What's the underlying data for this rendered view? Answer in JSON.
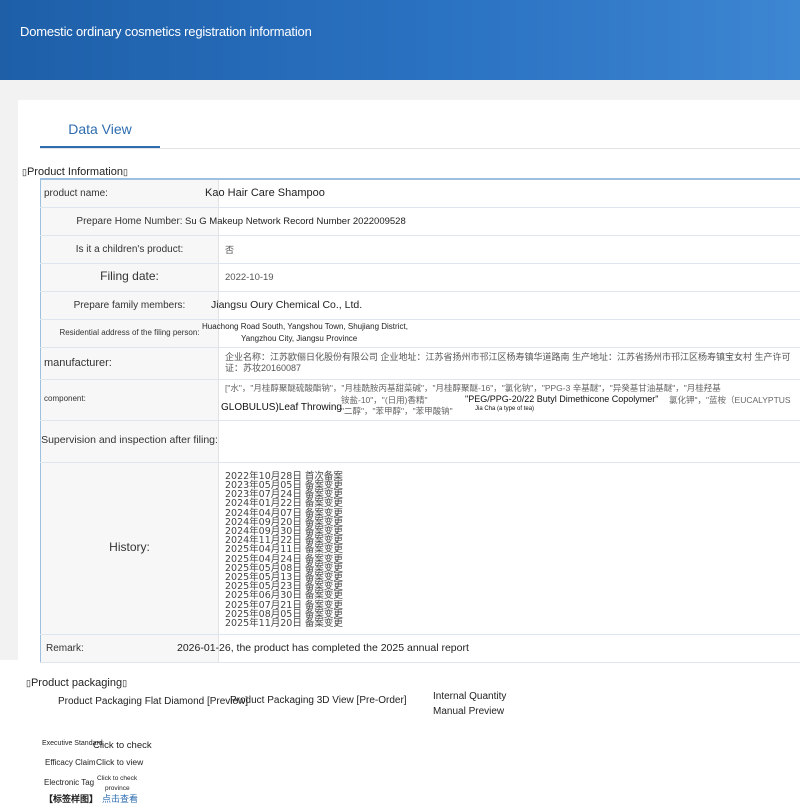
{
  "header": {
    "title": "Domestic ordinary cosmetics registration information"
  },
  "tabs": [
    {
      "label": "Data View"
    }
  ],
  "product_section": {
    "title": "Product Information"
  },
  "rows": {
    "product_name": {
      "label": "product name:",
      "value": "Kao Hair Care Shampoo"
    },
    "record_number": {
      "label": "Prepare Home Number:",
      "value": "Su G Makeup Network Record Number 2022009528"
    },
    "children": {
      "label": "Is it a children's product:",
      "value": "否"
    },
    "filing_date": {
      "label": "Filing date:",
      "value": "2022-10-19"
    },
    "family_members": {
      "label": "Prepare family members:",
      "value": "Jiangsu Oury Chemical Co., Ltd."
    },
    "residential": {
      "label": "Residential address of the filing person:",
      "value_line1": "Huachong Road South, Yangshou Town, Shujiang District,",
      "value_line2": "Yangzhou City, Jiangsu Province"
    },
    "manufacturer": {
      "label": "manufacturer:",
      "value": "企业名称：江苏欧俪日化股份有限公司 企业地址：江苏省扬州市邗江区杨寿镇华道路南 生产地址：江苏省扬州市邗江区杨寿镇宝女村 生产许可证：苏妆20160087"
    },
    "component": {
      "label": "component:",
      "value_cn1": "[\"水\"，\"月桂醇聚醚硫酸酯钠\"，\"月桂酰胺丙基甜菜碱\"，\"月桂醇聚醚-16\"，\"氯化钠\"，\"PPG-3 辛基醚\"，\"异癸基甘油基醚\"，\"月桂羟基",
      "value_cn2": "铵盐-10\"，\"(日用)香精\"",
      "value_en1": "\"PEG/PPG-20/22 Butyl Dimethicone Copolymer\"",
      "value_cn3": "氯化钾\"，\"蓝桉（EUCALYPTUS",
      "value_en2": "GLOBULUS)Leaf Throwing",
      "value_cn4": "\"二醇\"，\"苯甲醇\"，\"苯甲酸钠\"",
      "value_en3": "Jia Cha (a type of tea)"
    },
    "supervision": {
      "label": "Supervision and inspection after filing:",
      "value": ""
    },
    "history": {
      "label": "History:",
      "items": [
        "2022年10月28日 首次备案",
        "2023年05月05日 备案变更",
        "2023年07月24日 备案变更",
        "2024年01月22日 备案变更",
        "2024年04月07日 备案变更",
        "2024年09月20日 备案变更",
        "2024年09月30日 备案变更",
        "2024年11月22日 备案变更",
        "2025年04月11日 备案变更",
        "2025年04月24日 备案变更",
        "2025年05月08日 备案变更",
        "2025年05月13日 备案变更",
        "2025年05月23日 备案变更",
        "2025年06月30日 备案变更",
        "2025年07月21日 备案变更",
        "2025年08月05日 备案变更",
        "2025年11月20日 备案变更"
      ]
    },
    "remark": {
      "label": "Remark:",
      "value": "2026-01-26, the product has completed the 2025 annual report"
    }
  },
  "packaging": {
    "title": "Product packaging",
    "flat": "Product Packaging Flat Diamond [Preview]",
    "view3d": "Product Packaging 3D View [Pre-Order]",
    "internal_line1": "Internal Quantity",
    "internal_line2": "Manual Preview"
  },
  "extras": {
    "exec_label": "Executive Standard",
    "exec_link": "Click to check",
    "efficacy_label": "Efficacy Claim",
    "efficacy_link": "Click to view",
    "etag_label": "Electronic Tag",
    "etag_link_line1": "Click to check",
    "etag_link_line2": "province",
    "bottom_label": "【标签样图】",
    "bottom_link": "点击查看"
  },
  "colors": {
    "header": "#1e5fa8",
    "accent": "#2e6db0",
    "table_border": "#9ec0e0"
  }
}
